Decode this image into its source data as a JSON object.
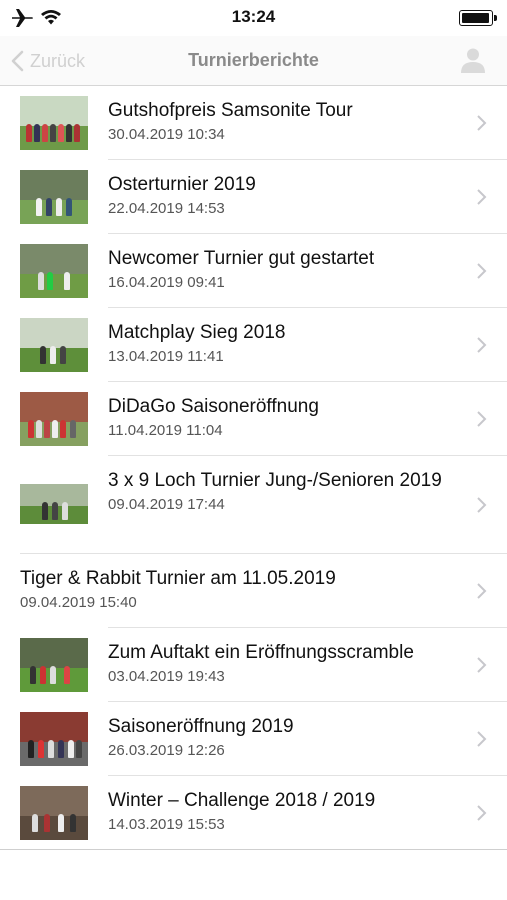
{
  "status_bar": {
    "time": "13:24"
  },
  "nav": {
    "back_label": "Zurück",
    "title": "Turnierberichte"
  },
  "items": [
    {
      "title": "Gutshofpreis Samsonite Tour",
      "date": "30.04.2019 10:34",
      "has_image": true
    },
    {
      "title": "Osterturnier 2019",
      "date": "22.04.2019 14:53",
      "has_image": true
    },
    {
      "title": "Newcomer Turnier gut gestartet",
      "date": "16.04.2019 09:41",
      "has_image": true
    },
    {
      "title": "Matchplay Sieg 2018",
      "date": "13.04.2019 11:41",
      "has_image": true
    },
    {
      "title": "DiDaGo Saisoneröffnung",
      "date": "11.04.2019 11:04",
      "has_image": true
    },
    {
      "title": "3 x 9 Loch Turnier Jung-/Senioren 2019",
      "date": "09.04.2019 17:44",
      "has_image": true
    },
    {
      "title": "Tiger & Rabbit Turnier am 11.05.2019",
      "date": "09.04.2019 15:40",
      "has_image": false
    },
    {
      "title": "Zum Auftakt ein Eröffnungsscramble",
      "date": "03.04.2019 19:43",
      "has_image": true
    },
    {
      "title": "Saisoneröffnung 2019",
      "date": "26.03.2019 12:26",
      "has_image": true
    },
    {
      "title": "Winter – Challenge 2018 / 2019",
      "date": "14.03.2019 15:53",
      "has_image": true
    }
  ],
  "colors": {
    "nav_title": "#8a8a8a",
    "back_disabled": "#d0d0d0",
    "chevron": "#c7c7cc",
    "grass": "#5a8f3c"
  }
}
